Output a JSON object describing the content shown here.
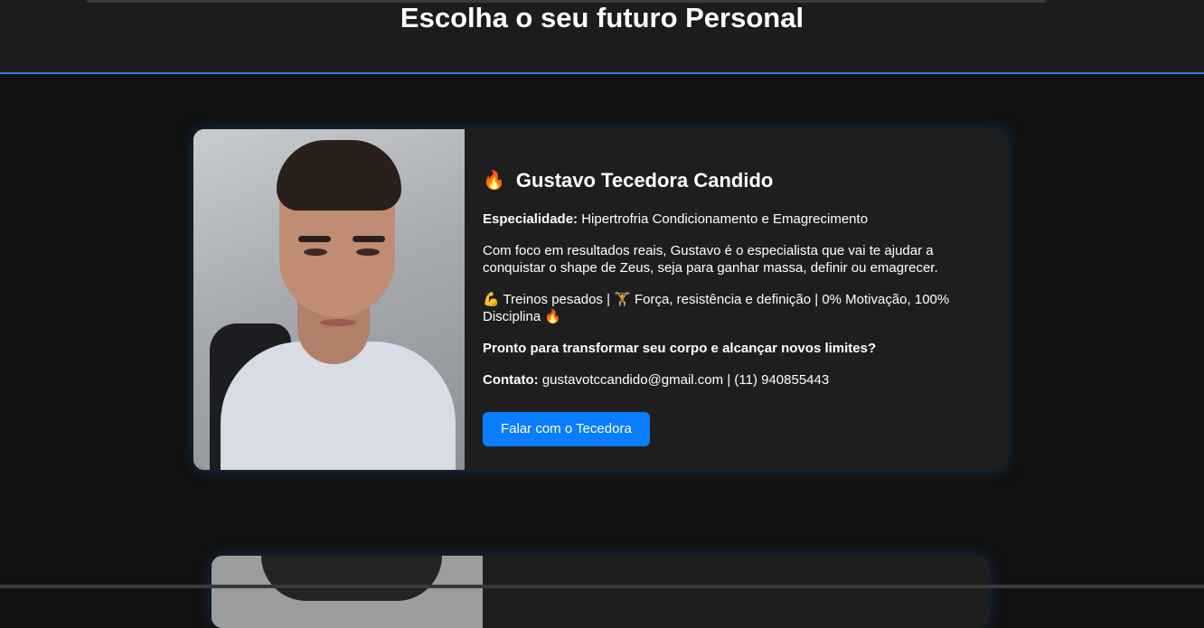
{
  "header": {
    "title": "Escolha o seu futuro Personal"
  },
  "trainer": {
    "name": "Gustavo Tecedora Candido",
    "name_icon": "fire-icon",
    "specialty_label": "Especialidade:",
    "specialty_value": " Hipertrofria Condicionamento e Emagrecimento",
    "description": "Com foco em resultados reais, Gustavo é o especialista que vai te ajudar a conquistar o shape de Zeus, seja para ganhar massa, definir ou emagrecer.",
    "highlights": "💪 Treinos pesados | 🏋 Força, resistência e definição | 0% Motivação, 100% Disciplina 🔥",
    "call_to_action_text": "Pronto para transformar seu corpo e alcançar novos limites?",
    "contact_label": "Contato:",
    "contact_value": " gustavotccandido@gmail.com | (11) 940855443",
    "button_label": "Falar com o Tecedora"
  },
  "colors": {
    "background": "#111111",
    "header_border": "#2f7de1",
    "card_background": "#1e1e1e",
    "button": "#0a7cff"
  }
}
